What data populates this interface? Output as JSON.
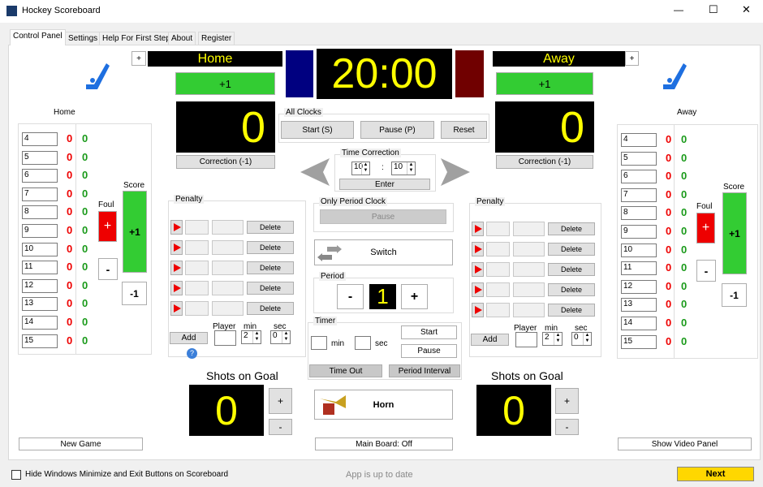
{
  "window": {
    "title": "Hockey Scoreboard",
    "minimize": "—",
    "maximize": "☐",
    "close": "✕"
  },
  "tabs": [
    "Control Panel",
    "Settings",
    "Help For First Step",
    "About",
    "Register"
  ],
  "home": {
    "name": "Home",
    "plus_one": "+1",
    "score": "0",
    "correction": "Correction (-1)",
    "list_title": "Home",
    "players": [
      "4",
      "5",
      "6",
      "7",
      "8",
      "9",
      "10",
      "11",
      "12",
      "13",
      "14",
      "15"
    ],
    "fouls": [
      "0",
      "0",
      "0",
      "0",
      "0",
      "0",
      "0",
      "0",
      "0",
      "0",
      "0",
      "0"
    ],
    "goals": [
      "0",
      "0",
      "0",
      "0",
      "0",
      "0",
      "0",
      "0",
      "0",
      "0",
      "0",
      "0"
    ],
    "foul_label": "Foul",
    "foul_plus": "+",
    "foul_minus": "-",
    "score_label": "Score",
    "score_plus": "+1",
    "score_minus": "-1",
    "shots_label": "Shots on Goal",
    "shots": "0",
    "shots_plus": "+",
    "shots_minus": "-",
    "name_plus": "+"
  },
  "away": {
    "name": "Away",
    "plus_one": "+1",
    "score": "0",
    "correction": "Correction (-1)",
    "list_title": "Away",
    "players": [
      "4",
      "5",
      "6",
      "7",
      "8",
      "9",
      "10",
      "11",
      "12",
      "13",
      "14",
      "15"
    ],
    "fouls": [
      "0",
      "0",
      "0",
      "0",
      "0",
      "0",
      "0",
      "0",
      "0",
      "0",
      "0",
      "0"
    ],
    "goals": [
      "0",
      "0",
      "0",
      "0",
      "0",
      "0",
      "0",
      "0",
      "0",
      "0",
      "0",
      "0"
    ],
    "foul_label": "Foul",
    "foul_plus": "+",
    "foul_minus": "-",
    "score_label": "Score",
    "score_plus": "+1",
    "score_minus": "-1",
    "shots_label": "Shots on Goal",
    "shots": "0",
    "shots_plus": "+",
    "shots_minus": "-",
    "name_plus": "+"
  },
  "penalty": {
    "title": "Penalty",
    "delete": "Delete",
    "add": "Add",
    "player": "Player",
    "min": "min",
    "sec": "sec",
    "min_value": "2",
    "sec_value": "0"
  },
  "clock": {
    "time": "20:00",
    "home_color": "#000080",
    "away_color": "#700000"
  },
  "all_clocks": {
    "title": "All Clocks",
    "start": "Start (S)",
    "pause": "Pause (P)",
    "reset": "Reset"
  },
  "time_correction": {
    "title": "Time Correction",
    "min": "10",
    "sep": ":",
    "sec": "10",
    "enter": "Enter"
  },
  "period_clock": {
    "title": "Only Period Clock",
    "pause": "Pause"
  },
  "switch": "Switch",
  "period": {
    "title": "Period",
    "minus": "-",
    "value": "1",
    "plus": "+"
  },
  "timer": {
    "title": "Timer",
    "min": "min",
    "sec": "sec",
    "start": "Start",
    "pause": "Pause",
    "time_out": "Time Out",
    "period_interval": "Period Interval"
  },
  "horn": "Horn",
  "bottom": {
    "new_game": "New Game",
    "main_board": "Main Board: Off",
    "video_panel": "Show Video Panel",
    "hide_label": "Hide Windows Minimize and Exit Buttons on Scoreboard",
    "status": "App is up to date",
    "next": "Next"
  }
}
